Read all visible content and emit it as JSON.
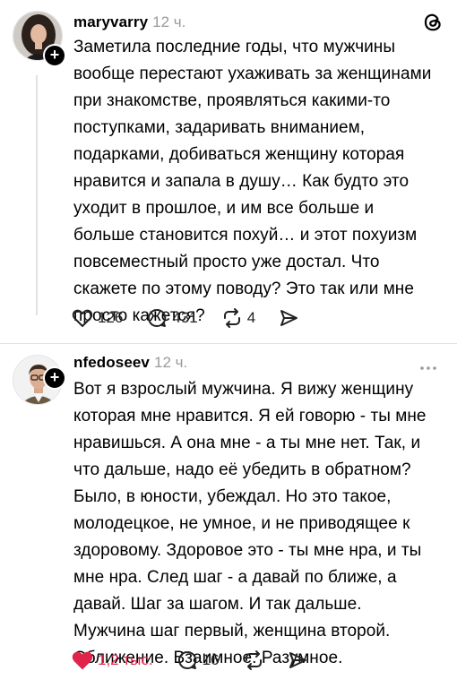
{
  "posts": [
    {
      "username": "maryvarry",
      "time": "12 ч.",
      "text": "Заметила последние годы, что мужчины\nвообще перестают ухаживать за женщинами\nпри знакомстве, проявляться какими-то\nпоступками, задаривать вниманием,\nподарками, добиваться женщину которая\nнравится и запала в душу… Как будто это\nуходит в прошлое, и им все больше и\nбольше становится похуй… и этот похуизм\nповсеместный просто уже достал. Что\nскажете по этому поводу? Это так или мне\nпросто кажется?",
      "likes": "126",
      "comments": "431",
      "reposts": "4",
      "liked": false,
      "follow_symbol": "+"
    },
    {
      "username": "nfedoseev",
      "time": "12 ч.",
      "text": "Вот я взрослый мужчина. Я вижу женщину\nкоторая мне нравится. Я ей говорю - ты мне\nнравишься. А она мне - а ты мне нет. Так, и\nчто дальше, надо её убедить в обратном?\nБыло, в юности, убеждал. Но это такое,\nмолодецкое, не умное, и не приводящее к\nздоровому. Здоровое это - ты мне нра, и ты\nмне нра. След шаг - а давай по ближе, а\nдавай. Шаг за шагом. И так дальше.\nМужчина шаг первый, женщина второй.\nСближение. Взаимное. Разумное.",
      "likes": "1,2 тыс.",
      "comments": "16",
      "reposts": "",
      "liked": true,
      "follow_symbol": "+"
    }
  ],
  "icons": {
    "app_logo": "threads-logo-icon",
    "more": "more-options-icon",
    "like": "heart-icon",
    "comment": "comment-icon",
    "repost": "repost-icon",
    "share": "share-icon"
  },
  "colors": {
    "liked": "#e0244a",
    "muted": "#9a9a9a",
    "divider": "#e0e0e0"
  }
}
